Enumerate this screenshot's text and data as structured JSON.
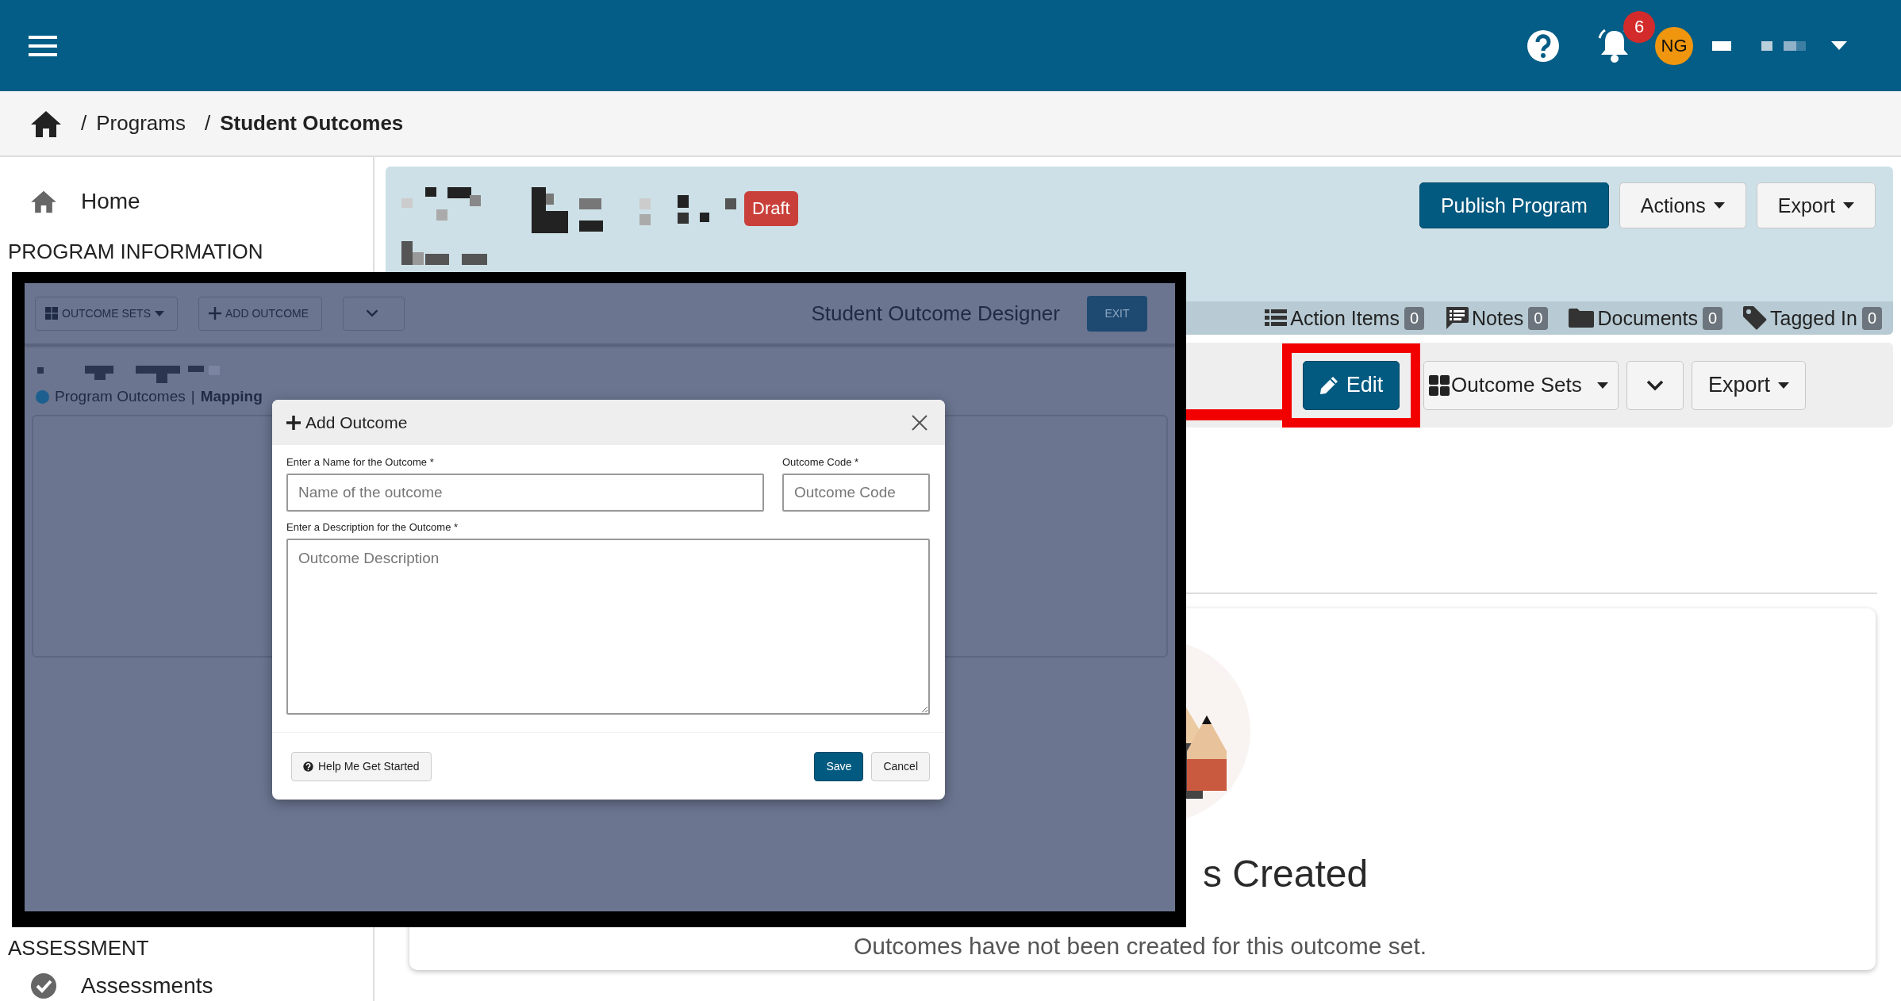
{
  "top_bar": {
    "notification_count": "6",
    "avatar_initials": "NG"
  },
  "breadcrumb": {
    "separator": "/",
    "items": [
      {
        "label": "Programs",
        "current": false
      },
      {
        "label": "Student Outcomes",
        "current": true
      }
    ]
  },
  "sidebar": {
    "top": [
      {
        "kind": "item",
        "label": "Home"
      },
      {
        "kind": "heading",
        "label": "PROGRAM INFORMATION"
      }
    ],
    "bottom": [
      {
        "kind": "heading",
        "label": "ASSESSMENT"
      },
      {
        "kind": "item",
        "label": "Assessments"
      }
    ]
  },
  "program_header": {
    "status_badge": "Draft",
    "buttons": [
      {
        "label": "Publish Program",
        "kind": "primary"
      },
      {
        "label": "Actions",
        "kind": "dropdown"
      },
      {
        "label": "Export",
        "kind": "dropdown"
      }
    ],
    "tabs": [
      {
        "label": "Action Items",
        "count": "0"
      },
      {
        "label": "Notes",
        "count": "0"
      },
      {
        "label": "Documents",
        "count": "0"
      },
      {
        "label": "Tagged In",
        "count": "0"
      }
    ]
  },
  "outcome_toolbar": {
    "buttons": [
      {
        "kind": "edit",
        "label": "Edit",
        "highlighted": true
      },
      {
        "kind": "sets",
        "label": "Outcome Sets",
        "highlighted": false
      },
      {
        "kind": "chevron",
        "highlighted": false
      },
      {
        "kind": "dropdown",
        "label": "Export",
        "highlighted": false
      }
    ]
  },
  "empty_state": {
    "title": "s Created",
    "message": "Outcomes have not been created for this outcome set."
  },
  "inset_screenshot": {
    "toolbar": {
      "buttons": [
        {
          "kind": "sets",
          "label": "OUTCOME SETS"
        },
        {
          "kind": "add",
          "label": "ADD OUTCOME"
        },
        {
          "kind": "chevron"
        }
      ],
      "title": "Student Outcome Designer",
      "exit": "EXIT"
    },
    "breadcrumb": {
      "scope": "Program Outcomes",
      "separator": "|",
      "method": "Mapping"
    },
    "dialog": {
      "title": "Add Outcome",
      "name_label": "Enter a Name for the Outcome *",
      "name_placeholder": "Name of the outcome",
      "code_label": "Outcome Code *",
      "code_placeholder": "Outcome Code",
      "description_label": "Enter a Description for the Outcome *",
      "description_placeholder": "Outcome Description",
      "help": "Help Me Get Started",
      "save": "Save",
      "cancel": "Cancel"
    }
  }
}
